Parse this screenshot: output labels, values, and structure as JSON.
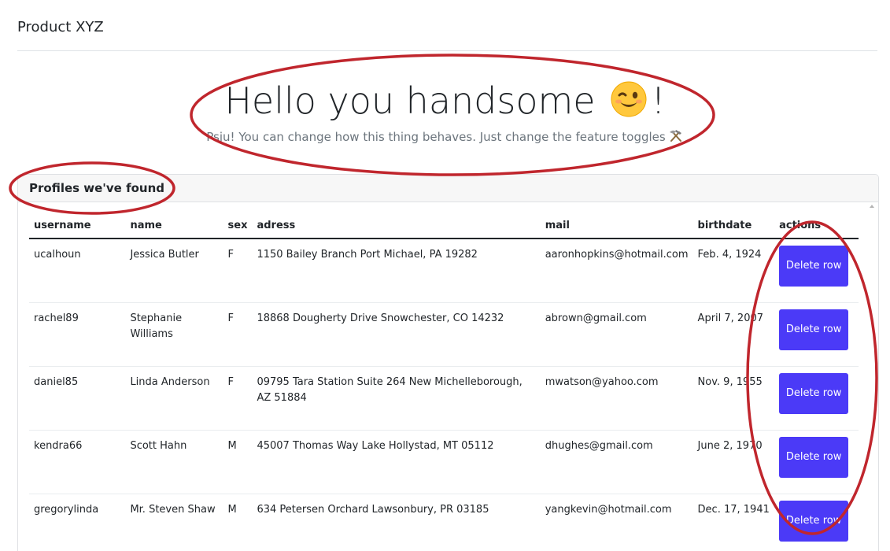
{
  "header": {
    "brand": "Product XYZ"
  },
  "hero": {
    "title_prefix": "Hello you handsome ",
    "title_suffix": "!",
    "emoji_icon": "winking-face-icon",
    "subtitle": "Psju! You can change how this thing behaves. Just change the feature toggles",
    "subtitle_icon": "hammer-and-pick-icon"
  },
  "card": {
    "title": "Profiles we've found"
  },
  "table": {
    "columns": [
      "username",
      "name",
      "sex",
      "adress",
      "mail",
      "birthdate",
      "actions"
    ],
    "rows": [
      {
        "username": "ucalhoun",
        "name": "Jessica Butler",
        "sex": "F",
        "adress": "1150 Bailey Branch Port Michael, PA 19282",
        "mail": "aaronhopkins@hotmail.com",
        "birthdate": "Feb. 4, 1924",
        "action": "Delete row"
      },
      {
        "username": "rachel89",
        "name": "Stephanie Williams",
        "sex": "F",
        "adress": "18868 Dougherty Drive Snowchester, CO 14232",
        "mail": "abrown@gmail.com",
        "birthdate": "April 7, 2007",
        "action": "Delete row"
      },
      {
        "username": "daniel85",
        "name": "Linda Anderson",
        "sex": "F",
        "adress": "09795 Tara Station Suite 264 New Michelleborough, AZ 51884",
        "mail": "mwatson@yahoo.com",
        "birthdate": "Nov. 9, 1955",
        "action": "Delete row"
      },
      {
        "username": "kendra66",
        "name": "Scott Hahn",
        "sex": "M",
        "adress": "45007 Thomas Way Lake Hollystad, MT 05112",
        "mail": "dhughes@gmail.com",
        "birthdate": "June 2, 1970",
        "action": "Delete row"
      },
      {
        "username": "gregorylinda",
        "name": "Mr. Steven Shaw",
        "sex": "M",
        "adress": "634 Petersen Orchard Lawsonbury, PR 03185",
        "mail": "yangkevin@hotmail.com",
        "birthdate": "Dec. 17, 1941",
        "action": "Delete row"
      }
    ]
  },
  "colors": {
    "button": "#4b3af7",
    "annotation": "#c0262d"
  }
}
